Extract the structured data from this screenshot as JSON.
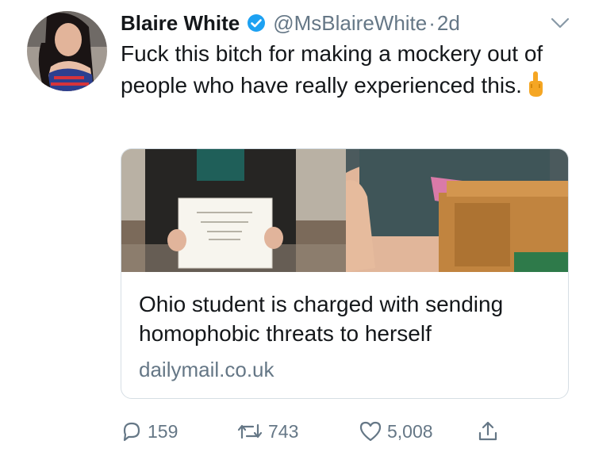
{
  "tweet": {
    "author_name": "Blaire White",
    "handle": "@MsBlaireWhite",
    "separator": "·",
    "time": "2d",
    "text": "Fuck this bitch for making a mockery out of people who have really experienced this.",
    "emoji_icon": "middle-finger-icon"
  },
  "card": {
    "title": "Ohio student is charged with sending homophobic threats to herself",
    "domain": "dailymail.co.uk"
  },
  "actions": {
    "replies": "159",
    "retweets": "743",
    "likes": "5,008"
  },
  "colors": {
    "text": "#14171a",
    "secondary": "#657786",
    "verified_blue": "#1da1f2",
    "border": "#d6dee4"
  }
}
